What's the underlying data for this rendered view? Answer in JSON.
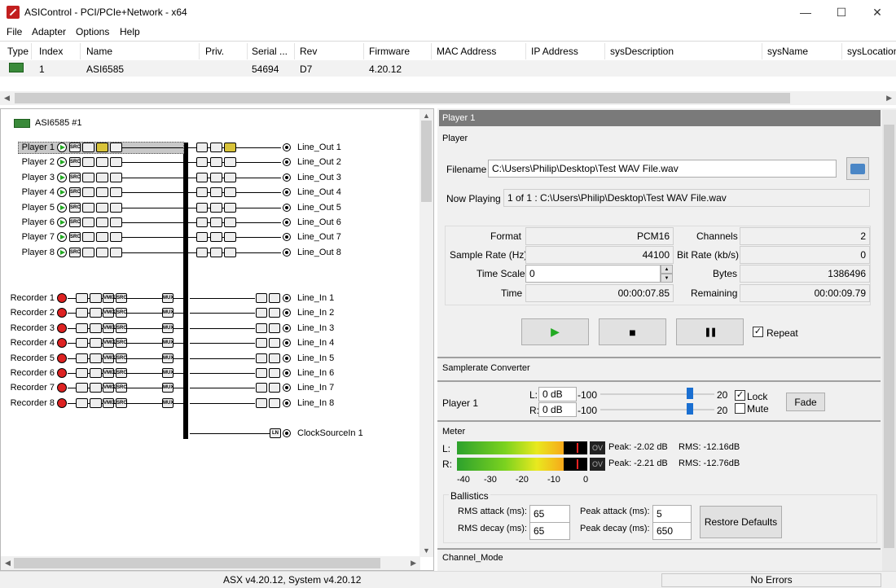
{
  "window": {
    "title": "ASIControl - PCI/PCIe+Network - x64",
    "minimize": "—",
    "maximize": "☐",
    "close": "✕"
  },
  "menu": [
    "File",
    "Adapter",
    "Options",
    "Help"
  ],
  "adapter_table": {
    "headers": [
      "Type",
      "Index",
      "Name",
      "Priv.",
      "Serial ...",
      "Rev",
      "Firmware",
      "MAC Address",
      "IP Address",
      "sysDescription",
      "sysName",
      "sysLocation"
    ],
    "row": {
      "index": "1",
      "name": "ASI6585",
      "serial": "54694",
      "rev": "D7",
      "firmware": "4.20.12"
    }
  },
  "tree": {
    "adapter_label": "ASI6585 #1",
    "players": [
      "Player  1",
      "Player  2",
      "Player  3",
      "Player  4",
      "Player  5",
      "Player  6",
      "Player  7",
      "Player  8"
    ],
    "line_outs": [
      "Line_Out  1",
      "Line_Out  2",
      "Line_Out  3",
      "Line_Out  4",
      "Line_Out  5",
      "Line_Out  6",
      "Line_Out  7",
      "Line_Out  8"
    ],
    "recorders": [
      "Recorder  1",
      "Recorder  2",
      "Recorder  3",
      "Recorder  4",
      "Recorder  5",
      "Recorder  6",
      "Recorder  7",
      "Recorder  8"
    ],
    "line_ins": [
      "Line_In  1",
      "Line_In  2",
      "Line_In  3",
      "Line_In  4",
      "Line_In  5",
      "Line_In  6",
      "Line_In  7",
      "Line_In  8"
    ],
    "clock": "ClockSourceIn  1",
    "block_src": "SRC",
    "block_mux": "MUX",
    "block_vmix": "VMIX",
    "block_ln": "LN"
  },
  "panel": {
    "header": "Player  1",
    "player_section": "Player",
    "filename_label": "Filename",
    "filename": "C:\\Users\\Philip\\Desktop\\Test WAV File.wav",
    "now_playing_label": "Now Playing",
    "now_playing": "1 of 1 : C:\\Users\\Philip\\Desktop\\Test WAV File.wav",
    "format_label": "Format",
    "format": "PCM16",
    "channels_label": "Channels",
    "channels": "2",
    "sample_rate_label": "Sample Rate (Hz)",
    "sample_rate": "44100",
    "bit_rate_label": "Bit Rate (kb/s)",
    "bit_rate": "0",
    "time_scale_label": "Time Scale",
    "time_scale": "0",
    "bytes_label": "Bytes",
    "bytes": "1386496",
    "time_label": "Time",
    "time": "00:00:07.85",
    "remaining_label": "Remaining",
    "remaining": "00:00:09.79",
    "play": "▶",
    "stop": "■",
    "pause": "❚❚",
    "repeat_label": "Repeat",
    "repeat_checked": true,
    "src_section": "Samplerate Converter",
    "src_player": "Player  1",
    "l_label": "L:",
    "l_value": "0 dB",
    "r_label": "R:",
    "r_value": "0 dB",
    "min": "-100",
    "max": "20",
    "lock_label": "Lock",
    "lock_checked": true,
    "mute_label": "Mute",
    "mute_checked": false,
    "fade": "Fade",
    "meter_section": "Meter",
    "meter_l": "L:",
    "meter_r": "R:",
    "ov": "OV",
    "peak_l": "Peak: -2.02 dB",
    "rms_l": "RMS: -12.16dB",
    "peak_r": "Peak: -2.21 dB",
    "rms_r": "RMS: -12.76dB",
    "meter_level_l": 0.82,
    "meter_level_r": 0.82,
    "scale": [
      "-40",
      "-30",
      "-20",
      "-10",
      "0"
    ],
    "ballistics": "Ballistics",
    "rms_attack_label": "RMS attack (ms):",
    "rms_attack": "65",
    "rms_decay_label": "RMS decay (ms):",
    "rms_decay": "65",
    "peak_attack_label": "Peak attack (ms):",
    "peak_attack": "5",
    "peak_decay_label": "Peak decay (ms):",
    "peak_decay": "650",
    "restore": "Restore Defaults",
    "channel_mode": "Channel_Mode"
  },
  "status": {
    "version": "ASX v4.20.12, System v4.20.12",
    "errors": "No Errors"
  }
}
